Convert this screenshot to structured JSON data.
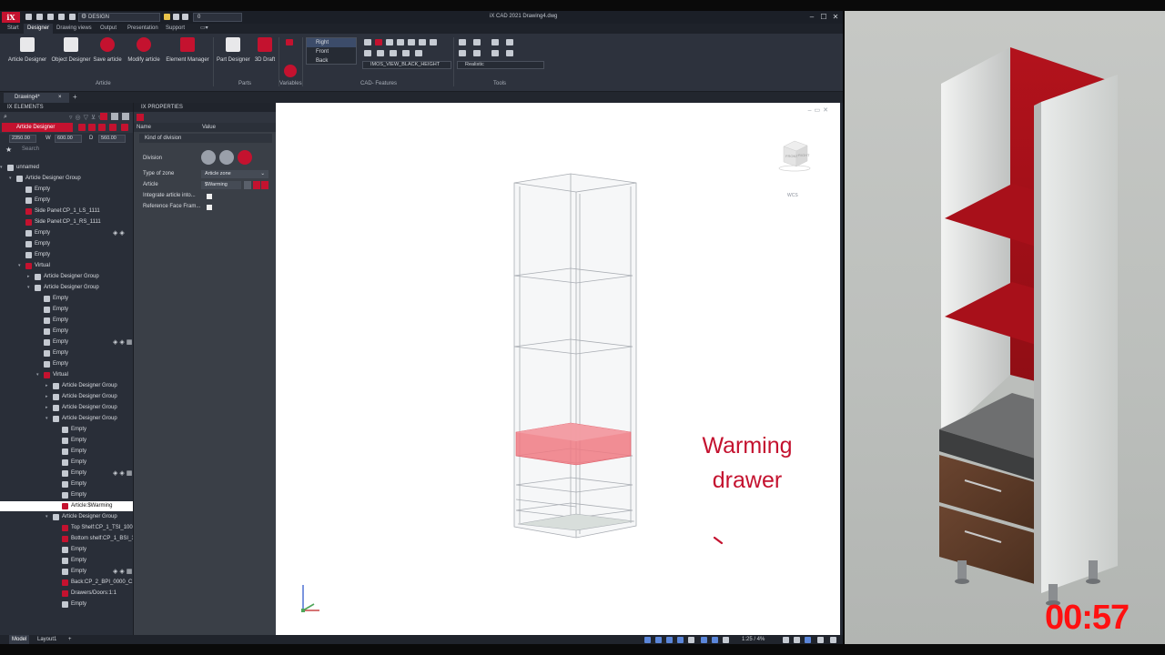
{
  "titlebar": {
    "logo": "iX",
    "workspace": "DESIGN",
    "layer": "0",
    "title": "iX CAD 2021 Drawing4.dwg"
  },
  "ribbon_tabs": [
    "Start",
    "Designer",
    "Drawing views",
    "Output",
    "Presentation",
    "Support"
  ],
  "ribbon": {
    "buttons": [
      {
        "label": "Article Designer"
      },
      {
        "label": "Object Designer"
      },
      {
        "label": "Save article"
      },
      {
        "label": "Modify article"
      },
      {
        "label": "Element Manager"
      },
      {
        "label": "Part Designer"
      },
      {
        "label": "3D Draft"
      }
    ],
    "groups": [
      "Article",
      "Parts",
      "Variables",
      "CAD- Features",
      "Tools"
    ],
    "views": [
      "Right",
      "Front",
      "Back"
    ],
    "view_dropdown": "IMOS_VIEW_BLACK_HEIGHT",
    "visual_style": "Realistic"
  },
  "document_tab": "Drawing4*",
  "elements_panel": {
    "header": "IX ELEMENTS",
    "article_designer_label": "Article Designer",
    "dims": {
      "h_value": "2350.00",
      "w_label": "W",
      "w_value": "600.00",
      "d_label": "D",
      "d_value": "560.00"
    },
    "search_placeholder": "Search",
    "tree": [
      {
        "label": "unnamed",
        "indent": 0,
        "icon": "g",
        "exp": "▾"
      },
      {
        "label": "Article Designer Group",
        "indent": 1,
        "icon": "g",
        "exp": "▾"
      },
      {
        "label": "Empty",
        "indent": 2,
        "icon": "g"
      },
      {
        "label": "Empty",
        "indent": 2,
        "icon": "g"
      },
      {
        "label": "Side Panel:CP_1_LS_1111",
        "indent": 2,
        "icon": "r"
      },
      {
        "label": "Side Panel:CP_1_RS_1111",
        "indent": 2,
        "icon": "r"
      },
      {
        "label": "Empty",
        "indent": 2,
        "icon": "g",
        "acts": "◈◈"
      },
      {
        "label": "Empty",
        "indent": 2,
        "icon": "g"
      },
      {
        "label": "Empty",
        "indent": 2,
        "icon": "g"
      },
      {
        "label": "Virtual",
        "indent": 2,
        "icon": "r",
        "exp": "▾"
      },
      {
        "label": "Article Designer Group",
        "indent": 3,
        "icon": "g",
        "exp": "▸"
      },
      {
        "label": "Article Designer Group",
        "indent": 3,
        "icon": "g",
        "exp": "▾"
      },
      {
        "label": "Empty",
        "indent": 4,
        "icon": "g"
      },
      {
        "label": "Empty",
        "indent": 4,
        "icon": "g"
      },
      {
        "label": "Empty",
        "indent": 4,
        "icon": "g"
      },
      {
        "label": "Empty",
        "indent": 4,
        "icon": "g"
      },
      {
        "label": "Empty",
        "indent": 4,
        "icon": "g",
        "acts": "◈◈▦"
      },
      {
        "label": "Empty",
        "indent": 4,
        "icon": "g"
      },
      {
        "label": "Empty",
        "indent": 4,
        "icon": "g"
      },
      {
        "label": "Virtual",
        "indent": 4,
        "icon": "r",
        "exp": "▾"
      },
      {
        "label": "Article Designer Group",
        "indent": 5,
        "icon": "g",
        "exp": "▸"
      },
      {
        "label": "Article Designer Group",
        "indent": 5,
        "icon": "g",
        "exp": "▸"
      },
      {
        "label": "Article Designer Group",
        "indent": 5,
        "icon": "g",
        "exp": "▸"
      },
      {
        "label": "Article Designer Group",
        "indent": 5,
        "icon": "g",
        "exp": "▾"
      },
      {
        "label": "Empty",
        "indent": 6,
        "icon": "g"
      },
      {
        "label": "Empty",
        "indent": 6,
        "icon": "g"
      },
      {
        "label": "Empty",
        "indent": 6,
        "icon": "g"
      },
      {
        "label": "Empty",
        "indent": 6,
        "icon": "g"
      },
      {
        "label": "Empty",
        "indent": 6,
        "icon": "g",
        "acts": "◈◈▦"
      },
      {
        "label": "Empty",
        "indent": 6,
        "icon": "g"
      },
      {
        "label": "Empty",
        "indent": 6,
        "icon": "g"
      },
      {
        "label": "Article:$Warming",
        "indent": 6,
        "icon": "r",
        "sel": true
      },
      {
        "label": "Article Designer Group",
        "indent": 5,
        "icon": "g",
        "exp": "▾"
      },
      {
        "label": "Top Shelf:CP_1_TSI_1000_C1_1",
        "indent": 6,
        "icon": "r"
      },
      {
        "label": "Bottom shelf:CP_1_BSI_1000_C",
        "indent": 6,
        "icon": "r"
      },
      {
        "label": "Empty",
        "indent": 6,
        "icon": "g"
      },
      {
        "label": "Empty",
        "indent": 6,
        "icon": "g"
      },
      {
        "label": "Empty",
        "indent": 6,
        "icon": "g",
        "acts": "◈◈▦"
      },
      {
        "label": "Back:CP_2_BPI_0000_C1",
        "indent": 6,
        "icon": "r"
      },
      {
        "label": "Drawers/Doors:1:1",
        "indent": 6,
        "icon": "r"
      },
      {
        "label": "Empty",
        "indent": 6,
        "icon": "g"
      }
    ]
  },
  "properties_panel": {
    "header": "IX PROPERTIES",
    "col_name": "Name",
    "col_value": "Value",
    "section": "Kind of division",
    "division_label": "Division",
    "type_of_zone_label": "Type of zone",
    "type_of_zone_value": "Article zone",
    "article_label": "Article",
    "article_value": "$Warming",
    "integrate_label": "Integrate article into...",
    "ref_face_label": "Reference Face Fram..."
  },
  "viewport": {
    "annotation_line1": "Warming",
    "annotation_line2": "drawer",
    "wcs": "WCS",
    "cube_front": "FRONT",
    "cube_right": "RIGHT"
  },
  "statusbar": {
    "tabs": [
      "Model",
      "Layout1"
    ],
    "scale": "1:25 / 4%"
  },
  "timer": "00:57",
  "colors": {
    "brand_red": "#c4122f",
    "timer_red": "#ff1010",
    "panel_dark": "#292e38"
  }
}
